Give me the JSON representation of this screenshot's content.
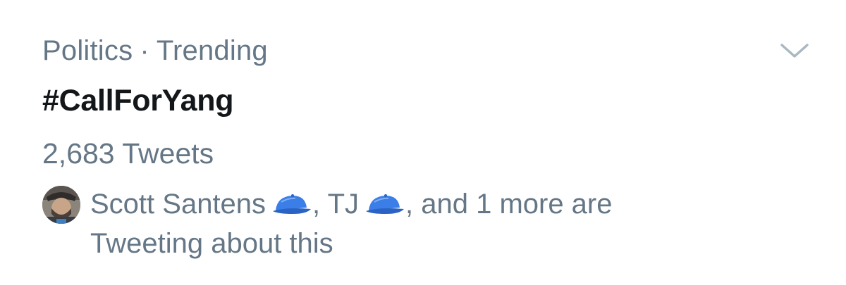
{
  "trend": {
    "category": "Politics",
    "separator": "·",
    "status": "Trending",
    "hashtag": "#CallForYang",
    "tweet_count": "2,683 Tweets",
    "social_context": {
      "user1": "Scott Santens",
      "comma1": ",",
      "user2": "TJ",
      "rest_line1": ", and 1 more are",
      "rest_line2": "Tweeting about this"
    },
    "icons": {
      "menu": "chevron-down-icon",
      "emoji": "blue-cap-emoji"
    }
  },
  "colors": {
    "secondary_text": "#657786",
    "primary_text": "#14171a",
    "chevron": "#aab8c2",
    "cap_blue": "#3b7ee8"
  }
}
